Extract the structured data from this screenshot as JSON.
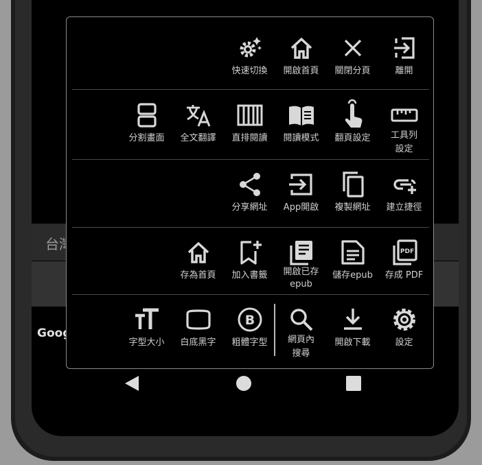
{
  "background": {
    "strip_text": "台灣",
    "bottom_text": "Goog"
  },
  "menu": {
    "rows": [
      [
        {
          "label": "快速切換",
          "icon": "gear-sparkle-icon"
        },
        {
          "label": "開啟首頁",
          "icon": "home-icon"
        },
        {
          "label": "關閉分頁",
          "icon": "close-icon"
        },
        {
          "label": "離開",
          "icon": "exit-icon"
        }
      ],
      [
        {
          "label": "分割畫面",
          "icon": "split-screen-icon"
        },
        {
          "label": "全文翻譯",
          "icon": "translate-icon"
        },
        {
          "label": "直排閱讀",
          "icon": "vertical-reading-icon"
        },
        {
          "label": "閱讀模式",
          "icon": "book-icon"
        },
        {
          "label": "翻頁設定",
          "icon": "touch-icon"
        },
        {
          "label": "工具列\n設定",
          "icon": "ruler-icon"
        }
      ],
      [
        {
          "label": "分享網址",
          "icon": "share-icon"
        },
        {
          "label": "App開啟",
          "icon": "open-in-app-icon"
        },
        {
          "label": "複製網址",
          "icon": "copy-icon"
        },
        {
          "label": "建立捷徑",
          "icon": "link-add-icon"
        }
      ],
      [
        {
          "label": "存為首頁",
          "icon": "home-save-icon"
        },
        {
          "label": "加入書籤",
          "icon": "bookmark-add-icon"
        },
        {
          "label": "開啟已存\nepub",
          "icon": "library-icon"
        },
        {
          "label": "儲存epub",
          "icon": "document-icon"
        },
        {
          "label": "存成 PDF",
          "icon": "pdf-icon"
        }
      ],
      [
        {
          "label": "字型大小",
          "icon": "font-size-icon"
        },
        {
          "label": "白底黑字",
          "icon": "contrast-frame-icon"
        },
        {
          "label": "粗體字型",
          "icon": "bold-icon"
        },
        {
          "label": "網頁內\n搜尋",
          "icon": "search-icon"
        },
        {
          "label": "開啟下載",
          "icon": "download-icon"
        },
        {
          "label": "設定",
          "icon": "settings-icon"
        }
      ]
    ]
  },
  "colors": {
    "menu_bg": "#000000",
    "icon": "#d8d8d8",
    "text": "#d0d0d0",
    "border": "#8a8a8a"
  }
}
